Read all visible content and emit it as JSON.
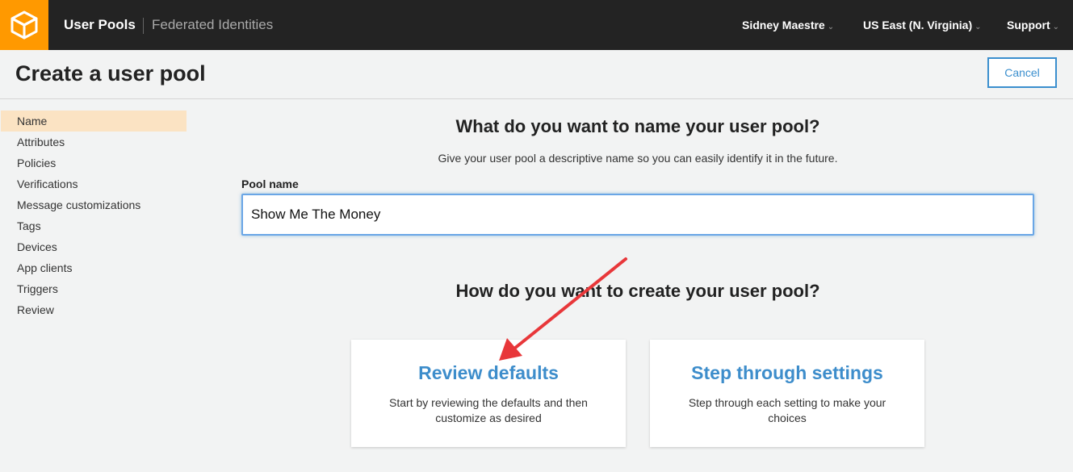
{
  "header": {
    "logo_icon": "cube-icon",
    "primary_link": "User Pools",
    "secondary_link": "Federated Identities",
    "menus": [
      {
        "label": "Sidney Maestre",
        "icon": "chevron-down-icon"
      },
      {
        "label": "US East (N. Virginia)",
        "icon": "chevron-down-icon"
      },
      {
        "label": "Support",
        "icon": "chevron-down-icon"
      }
    ]
  },
  "page": {
    "title": "Create a user pool",
    "cancel_label": "Cancel"
  },
  "sidebar": {
    "items": [
      {
        "label": "Name",
        "active": true
      },
      {
        "label": "Attributes"
      },
      {
        "label": "Policies"
      },
      {
        "label": "Verifications"
      },
      {
        "label": "Message customizations"
      },
      {
        "label": "Tags"
      },
      {
        "label": "Devices"
      },
      {
        "label": "App clients"
      },
      {
        "label": "Triggers"
      },
      {
        "label": "Review"
      }
    ]
  },
  "main": {
    "name_heading": "What do you want to name your user pool?",
    "name_description": "Give your user pool a descriptive name so you can easily identify it in the future.",
    "pool_name_label": "Pool name",
    "pool_name_value": "Show Me The Money",
    "create_heading": "How do you want to create your user pool?",
    "options": [
      {
        "title": "Review defaults",
        "description": "Start by reviewing the defaults and then customize as desired"
      },
      {
        "title": "Step through settings",
        "description": "Step through each setting to make your choices"
      }
    ]
  },
  "colors": {
    "brand_orange": "#ff9900",
    "topbar": "#232323",
    "link_blue": "#3d8dcb",
    "active_sidebar": "#fbe3c3",
    "annotation_arrow": "#e8373a"
  }
}
